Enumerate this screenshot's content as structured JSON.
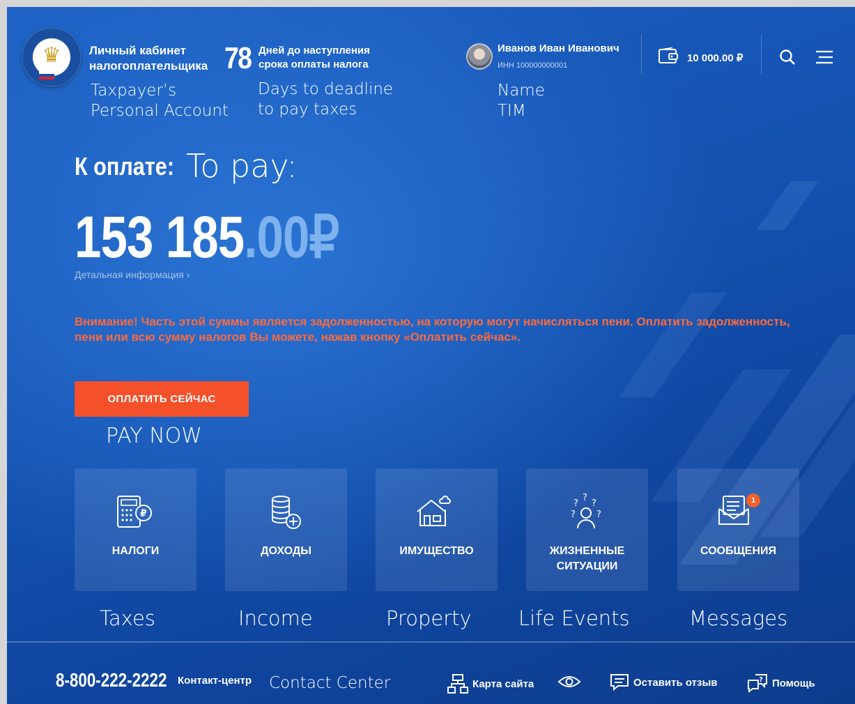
{
  "header": {
    "title_line1": "Личный кабинет",
    "title_line2": "налогоплательщика",
    "days_count": "78",
    "days_line1": "Дней до наступления",
    "days_line2": "срока оплаты налога",
    "user_name": "Иванов Иван Иванович",
    "user_inn": "ИНН 100000000001",
    "balance": "10 000.00 ₽"
  },
  "annotations": {
    "account_line1": "Taxpayer’s",
    "account_line2": "Personal Account",
    "deadline_line1": "Days to deadline",
    "deadline_line2": "to pay taxes",
    "name_line1": "Name",
    "name_line2": "TIM",
    "to_pay": "To pay:",
    "pay_now": "PAY NOW",
    "taxes": "Taxes",
    "income": "Income",
    "property": "Property",
    "life_events": "Life Events",
    "messages": "Messages",
    "contact_center": "Contact Center"
  },
  "main": {
    "pay_label": "К оплате:",
    "amount_int": "153 185",
    "amount_dec": ".00",
    "currency": "₽",
    "detail_link": "Детальная информация ›",
    "warning": "Внимание! Часть этой суммы является задолженностью, на которую могут начисляться пени. Оплатить задолженность, пени или всю сумму налогов Вы можете, нажав кнопку «Оплатить сейчас».",
    "pay_button": "ОПЛАТИТЬ СЕЙЧАС"
  },
  "tiles": [
    {
      "label": "НАЛОГИ",
      "icon": "calculator-ruble-icon"
    },
    {
      "label": "ДОХОДЫ",
      "icon": "coins-plus-icon"
    },
    {
      "label": "ИМУЩЕСТВО",
      "icon": "house-icon"
    },
    {
      "label_line1": "ЖИЗНЕННЫЕ",
      "label_line2": "СИТУАЦИИ",
      "icon": "person-questions-icon"
    },
    {
      "label": "СООБЩЕНИЯ",
      "icon": "envelope-icon",
      "badge": "1"
    }
  ],
  "footer": {
    "phone": "8-800-222-2222",
    "contact_label": "Контакт-центр",
    "sitemap": "Карта сайта",
    "feedback": "Оставить отзыв",
    "help": "Помощь"
  },
  "colors": {
    "background": "#1553b3",
    "accent": "#f4502a",
    "warning_text": "#ff6a3d",
    "decimal": "#7eb2ee"
  }
}
